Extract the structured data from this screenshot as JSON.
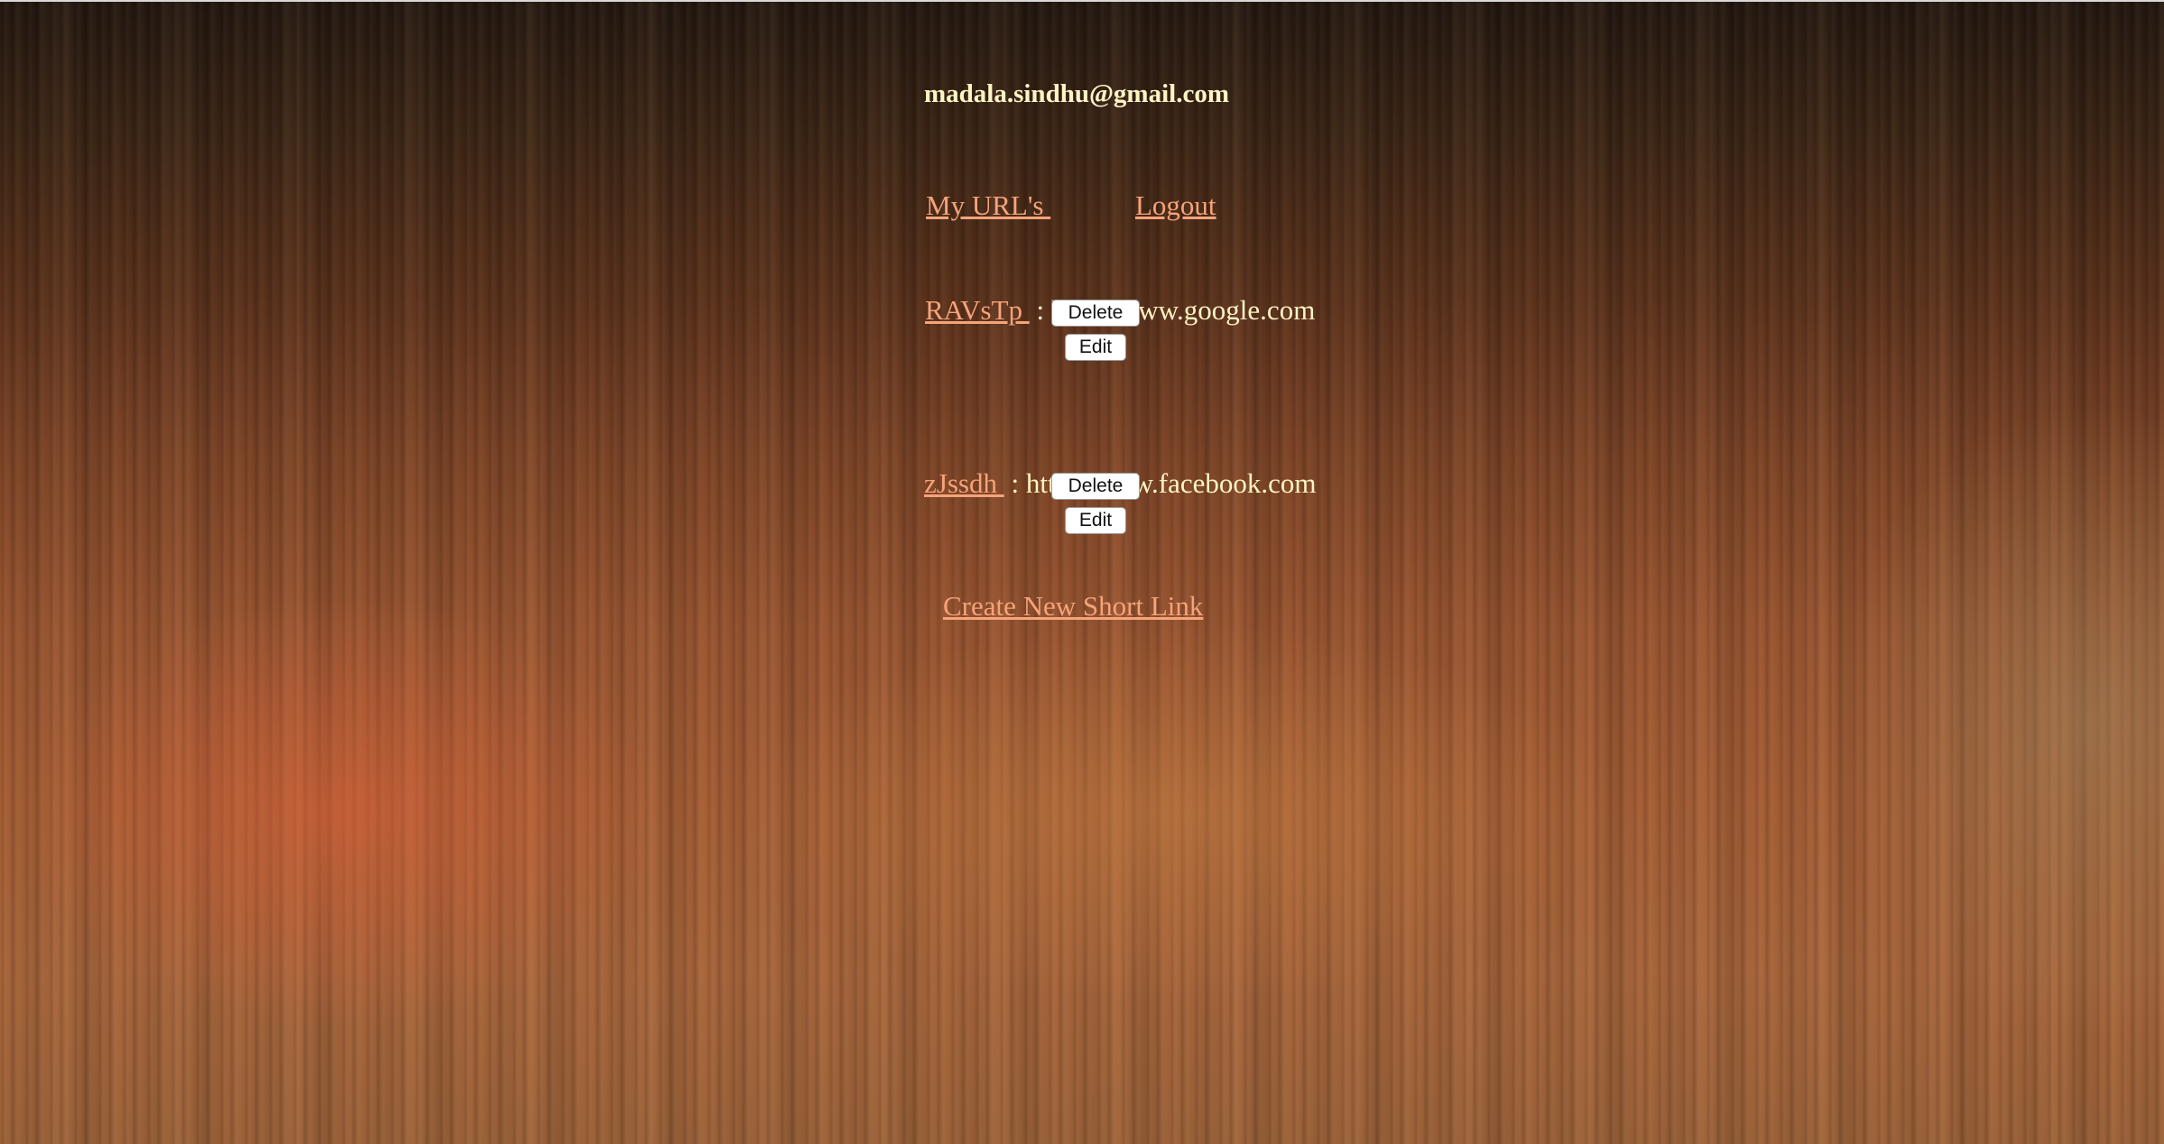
{
  "user": {
    "email": "madala.sindhu@gmail.com"
  },
  "nav": {
    "my_urls_label": "My URL's ",
    "logout_label": "Logout"
  },
  "urls": [
    {
      "short_code": "RAVsTp ",
      "separator": " : ",
      "long_url": "http://www.google.com",
      "delete_label": "Delete",
      "edit_label": "Edit"
    },
    {
      "short_code": "zJssdh ",
      "separator": " : ",
      "long_url": "http://www.facebook.com",
      "delete_label": "Delete",
      "edit_label": "Edit"
    }
  ],
  "actions": {
    "create_label": "Create New Short Link"
  },
  "colors": {
    "link": "#f6a37a",
    "text": "#fff4c4"
  }
}
